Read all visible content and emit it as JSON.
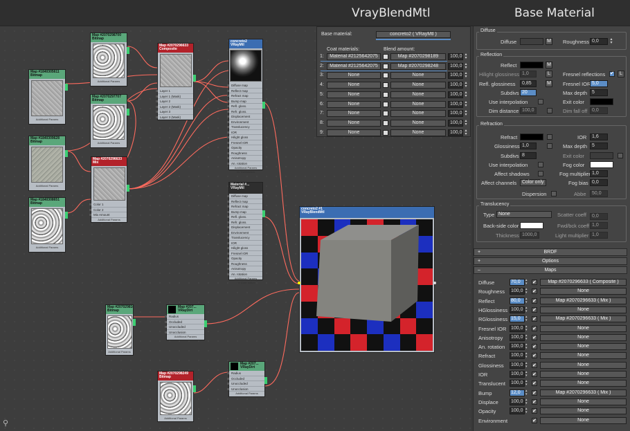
{
  "titles": {
    "left": "VrayBlendMtl",
    "right": "Base Material"
  },
  "nodes": {
    "bmp1": {
      "title": "Map #2070298700",
      "sub": "Bitmap",
      "foot": "Additional Params"
    },
    "bmp2": {
      "title": "Map #2070297707",
      "sub": "Bitmap",
      "foot": "Additional Params"
    },
    "bmp3": {
      "title": "Map #1840305611",
      "sub": "Bitmap",
      "foot": "Additional Params"
    },
    "bmp4": {
      "title": "Map #1840309628",
      "sub": "Bitmap",
      "foot": "Additional Params"
    },
    "bmp5": {
      "title": "Map #1840308651",
      "sub": "Bitmap",
      "foot": "Additional Params"
    },
    "comp": {
      "title": "Map #2070296633",
      "sub": "Composite",
      "slots": [
        "Layer 1",
        "Layer 1 (Mask)",
        "Layer 2",
        "Layer 2 (Mask)",
        "Layer 3",
        "Layer 3 (Mask)"
      ]
    },
    "mix": {
      "title": "Map #2070296633",
      "sub": "Mix",
      "slots": [
        "Color 1",
        "Color 2",
        "Mix Amount"
      ],
      "foot": "Additional Params"
    },
    "vray1": {
      "title": "concreto2",
      "sub": "VRayMtl",
      "slots": [
        "Diffuse map",
        "Reflect map",
        "Refract map",
        "Bump map",
        "Refl. gloss.",
        "Refr. gloss.",
        "Displacement",
        "Environment",
        "Translucency",
        "IOR",
        "Hilight gloss",
        "Fresnel IOR",
        "Opacity",
        "Roughness",
        "Anisotropy",
        "An. rotation"
      ],
      "foot1": "Additional Params",
      "foot2": "mr Connection"
    },
    "vray2": {
      "title": "Material #...",
      "sub": "VRayMtl",
      "slots": [
        "Diffuse map",
        "Reflect map",
        "Refract map",
        "Bump map",
        "Refl. gloss.",
        "Refr. gloss.",
        "Displacement",
        "Environment",
        "Translucency",
        "IOR",
        "Hilight gloss",
        "Fresnel IOR",
        "Opacity",
        "Roughness",
        "Anisotropy",
        "An. rotation"
      ],
      "foot1": "Additional Params",
      "foot2": "mr Connection"
    },
    "bmp6": {
      "title": "Map #2070298100",
      "sub": "Bitmap",
      "foot": "Additional Params"
    },
    "bmp7": {
      "title": "Map #2070298249",
      "sub": "Bitmap",
      "foot": "Additional Params"
    },
    "dirt1": {
      "title": "Map #207...",
      "sub": "VRayDirt",
      "slots": [
        "Radius",
        "Occluded",
        "Unoccluded",
        "Unocclusion"
      ],
      "foot": "Additional Params"
    },
    "dirt2": {
      "title": "Map #207...",
      "sub": "VRayDirt",
      "slots": [
        "Radius",
        "Occluded",
        "Unoccluded",
        "Unocclusion"
      ],
      "foot": "Additional Params"
    },
    "blend": {
      "title": "concreto2 #1",
      "sub": "VRayBlendMtl"
    }
  },
  "blend_panel": {
    "base_label": "Base material:",
    "base_value": "concreto2  ( VRayMtl )",
    "coat_header": "Coat materials:",
    "amount_header": "Blend amount:",
    "rows": [
      {
        "n": "1:",
        "coat": "Material #2125642075",
        "amt": "Map #2070298189",
        "val": "100,0"
      },
      {
        "n": "2:",
        "coat": "Material #2125642075",
        "amt": "Map #2070298248",
        "val": "100,0"
      },
      {
        "n": "3:",
        "coat": "None",
        "amt": "None",
        "val": "100,0"
      },
      {
        "n": "4:",
        "coat": "None",
        "amt": "None",
        "val": "100,0"
      },
      {
        "n": "5:",
        "coat": "None",
        "amt": "None",
        "val": "100,0"
      },
      {
        "n": "6:",
        "coat": "None",
        "amt": "None",
        "val": "100,0"
      },
      {
        "n": "7:",
        "coat": "None",
        "amt": "None",
        "val": "100,0"
      },
      {
        "n": "8:",
        "coat": "None",
        "amt": "None",
        "val": "100,0"
      },
      {
        "n": "9:",
        "coat": "None",
        "amt": "None",
        "val": "100,0"
      }
    ]
  },
  "base": {
    "diffuse_group": "Diffuse",
    "diffuse": "Diffuse",
    "m": "M",
    "roughness": "Roughness",
    "roughness_val": "0,0",
    "refl_group": "Reflection",
    "reflect": "Reflect",
    "hilight": "Hilight glossiness",
    "hilight_val": "1,0",
    "l": "L",
    "fresnel": "Fresnel reflections",
    "refl_gloss": "Refl. glossiness",
    "refl_gloss_val": "0,85",
    "fresnel_ior": "Fresnel IOR",
    "fresnel_ior_val": "5,0",
    "subdivs": "Subdivs",
    "subdivs_val": "20",
    "max_depth": "Max depth",
    "max_depth_val": "5",
    "use_interp": "Use interpolation",
    "exit_color": "Exit color",
    "dim_dist": "Dim distance",
    "dim_dist_val": "100,0",
    "dim_falloff": "Dim fall off",
    "dim_falloff_val": "0,0",
    "refr_group": "Refraction",
    "refract": "Refract",
    "ior": "IOR",
    "ior_val": "1,6",
    "gloss": "Glossiness",
    "gloss_val": "1,0",
    "rmax": "Max depth",
    "rmax_val": "5",
    "rsub": "Subdivs",
    "rsub_val": "8",
    "rexit": "Exit color",
    "ruse": "Use interpolation",
    "fog": "Fog color",
    "affect_sh": "Affect shadows",
    "fog_mult": "Fog multiplier",
    "fog_mult_val": "1,0",
    "affect_ch": "Affect channels",
    "affect_ch_val": "Color only",
    "fog_bias": "Fog bias",
    "fog_bias_val": "0,0",
    "dispersion": "Dispersion",
    "abbe": "Abbe",
    "abbe_val": "50,0",
    "tr_group": "Translucency",
    "type": "Type",
    "type_val": "None",
    "scatter": "Scatter coeff",
    "scatter_val": "0,0",
    "backside": "Back-side color",
    "fwd": "Fwd/bck coeff",
    "fwd_val": "1,0",
    "thick": "Thickness",
    "thick_val": "1000,0",
    "light_mult": "Light multiplier",
    "light_mult_val": "1,0"
  },
  "rollouts": {
    "brdf": "BRDF",
    "options": "Options",
    "maps": "Maps"
  },
  "maps": [
    {
      "label": "Diffuse",
      "amt": "70,0",
      "hl": true,
      "map": "Map #2070296633  ( Composite )"
    },
    {
      "label": "Roughness",
      "amt": "100,0",
      "hl": false,
      "map": "None"
    },
    {
      "label": "Reflect",
      "amt": "80,0",
      "hl": true,
      "map": "Map #2070296633  ( Mix )"
    },
    {
      "label": "HGlossiness",
      "amt": "100,0",
      "hl": false,
      "map": "None"
    },
    {
      "label": "RGlossiness",
      "amt": "15,0",
      "hl": true,
      "map": "Map #2070296633  ( Mix )"
    },
    {
      "label": "Fresnel IOR",
      "amt": "100,0",
      "hl": false,
      "map": "None"
    },
    {
      "label": "Anisotropy",
      "amt": "100,0",
      "hl": false,
      "map": "None"
    },
    {
      "label": "An. rotation",
      "amt": "100,0",
      "hl": false,
      "map": "None"
    },
    {
      "label": "Refract",
      "amt": "100,0",
      "hl": false,
      "map": "None"
    },
    {
      "label": "Glossiness",
      "amt": "100,0",
      "hl": false,
      "map": "None"
    },
    {
      "label": "IOR",
      "amt": "100,0",
      "hl": false,
      "map": "None"
    },
    {
      "label": "Translucent",
      "amt": "100,0",
      "hl": false,
      "map": "None"
    },
    {
      "label": "Bump",
      "amt": "12,0",
      "hl": true,
      "map": "Map #2070296633  ( Mix )"
    },
    {
      "label": "Displace",
      "amt": "100,0",
      "hl": false,
      "map": "None"
    },
    {
      "label": "Opacity",
      "amt": "100,0",
      "hl": false,
      "map": "None"
    },
    {
      "label": "Environment",
      "amt": "",
      "hl": false,
      "map": "None"
    }
  ],
  "colors": {
    "wire": "#ff6b5e",
    "port": "#ffff00",
    "accent": "#5b8dc6",
    "node_header_green": "#5aa77a",
    "node_header_red": "#b3222a"
  }
}
